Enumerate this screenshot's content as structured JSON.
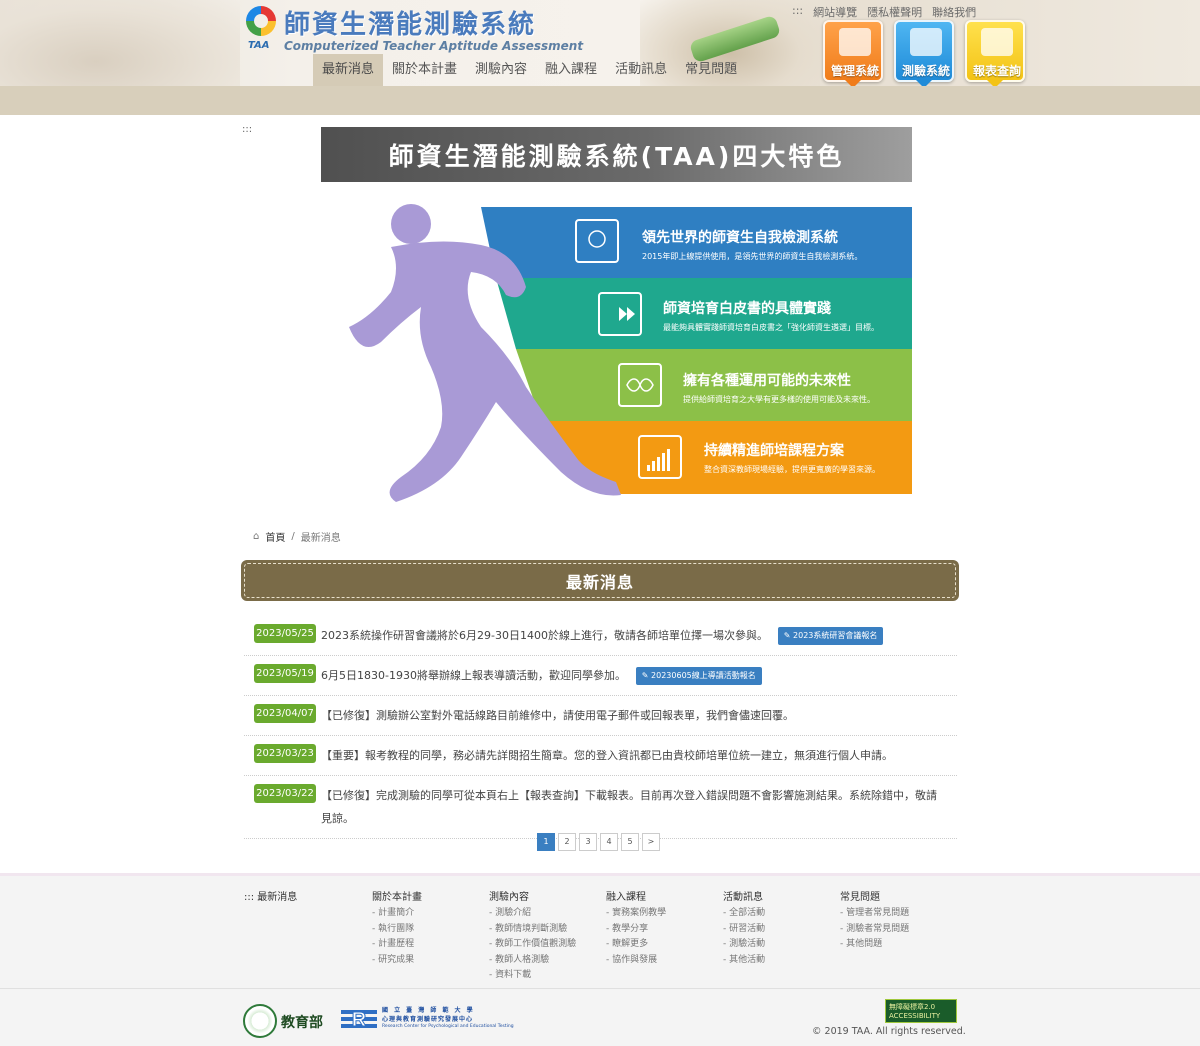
{
  "header": {
    "logo_zh": "師資生潛能測驗系統",
    "logo_abbr": "TAA",
    "logo_en": "Computerized Teacher Aptitude Assessment",
    "top_links": [
      ":::",
      "網站導覽",
      "隱私權聲明",
      "聯絡我們"
    ],
    "nav": [
      "最新消息",
      "關於本計畫",
      "測驗內容",
      "融入課程",
      "活動訊息",
      "常見問題"
    ],
    "nav_active": "最新消息",
    "system_buttons": [
      {
        "label": "管理系統",
        "icon": "monitor-icon",
        "color": "#f07c1a"
      },
      {
        "label": "測驗系統",
        "icon": "clipboard-pen-icon",
        "color": "#1f8bd8"
      },
      {
        "label": "報表查詢",
        "icon": "report-map-icon",
        "color": "#f3c315"
      }
    ]
  },
  "accessibility_marker": ":::",
  "banner": {
    "title": "師資生潛能測驗系統(TAA)四大特色",
    "features": [
      {
        "title": "領先世界的師資生自我檢測系統",
        "desc": "2015年即上線提供使用，是領先世界的師資生自我檢測系統。",
        "color": "#2f7fc2",
        "icon": "globe-monitor-icon"
      },
      {
        "title": "師資培育白皮書的具體實踐",
        "desc": "最能夠具體實踐師資培育白皮書之「強化師資生遴選」目標。",
        "color": "#1fa88e",
        "icon": "play-forward-icon"
      },
      {
        "title": "擁有各種運用可能的未來性",
        "desc": "提供給師資培育之大學有更多樣的使用可能及未來性。",
        "color": "#8cc048",
        "icon": "infinity-icon"
      },
      {
        "title": "持續精進師培課程方案",
        "desc": "整合資深教師現場經驗，提供更寬廣的學習來源。",
        "color": "#f39a12",
        "icon": "bar-chart-icon"
      }
    ]
  },
  "breadcrumb": {
    "home": "首頁",
    "current": "最新消息"
  },
  "section_title": "最新消息",
  "news": [
    {
      "date": "2023/05/25",
      "text": "2023系統操作研習會議將於6月29-30日1400於線上進行，敬請各師培單位擇一場次參與。",
      "button": "2023系統研習會議報名"
    },
    {
      "date": "2023/05/19",
      "text": "6月5日1830-1930將舉辦線上報表導讀活動，歡迎同學參加。",
      "button": "20230605線上導讀活動報名"
    },
    {
      "date": "2023/04/07",
      "text": "【已修復】測驗辦公室對外電話線路目前維修中，請使用電子郵件或回報表單，我們會儘速回覆。",
      "button": ""
    },
    {
      "date": "2023/03/23",
      "text": "【重要】報考教程的同學，務必請先詳閱招生簡章。您的登入資訊都已由貴校師培單位統一建立，無須進行個人申請。",
      "button": ""
    },
    {
      "date": "2023/03/22",
      "text": "【已修復】完成測驗的同學可從本頁右上【報表查詢】下載報表。目前再次登入錯誤問題不會影響施測結果。系統除錯中，敬請見諒。",
      "button": ""
    }
  ],
  "pagination": {
    "pages": [
      "1",
      "2",
      "3",
      "4",
      "5",
      ">"
    ],
    "current": "1"
  },
  "footer": {
    "columns": [
      {
        "heading": "::: 最新消息",
        "links": []
      },
      {
        "heading": "關於本計畫",
        "links": [
          "- 計畫簡介",
          "- 執行團隊",
          "- 計畫歷程",
          "- 研究成果"
        ]
      },
      {
        "heading": "測驗內容",
        "links": [
          "- 測驗介紹",
          "- 教師情境判斷測驗",
          "- 教師工作價值觀測驗",
          "- 教師人格測驗",
          "- 資料下載"
        ]
      },
      {
        "heading": "融入課程",
        "links": [
          "- 實務案例教學",
          "- 教學分享",
          "- 瞭解更多",
          "- 協作與發展"
        ]
      },
      {
        "heading": "活動訊息",
        "links": [
          "- 全部活動",
          "- 研習活動",
          "- 測驗活動",
          "- 其他活動"
        ]
      },
      {
        "heading": "常見問題",
        "links": [
          "- 管理者常見問題",
          "- 測驗者常見問題",
          "- 其他問題"
        ]
      }
    ],
    "moe_label": "教育部",
    "ntnu_line1": "國 立 臺 灣 師 範 大 學",
    "ntnu_line2": "心理與教育測驗研究發展中心",
    "ntnu_line3": "Research Center for Psychological and Educational Testing",
    "accessibility_badge": "無障礙標章2.0 ACCESSIBILITY",
    "copyright": "© 2019 TAA. All rights reserved."
  }
}
